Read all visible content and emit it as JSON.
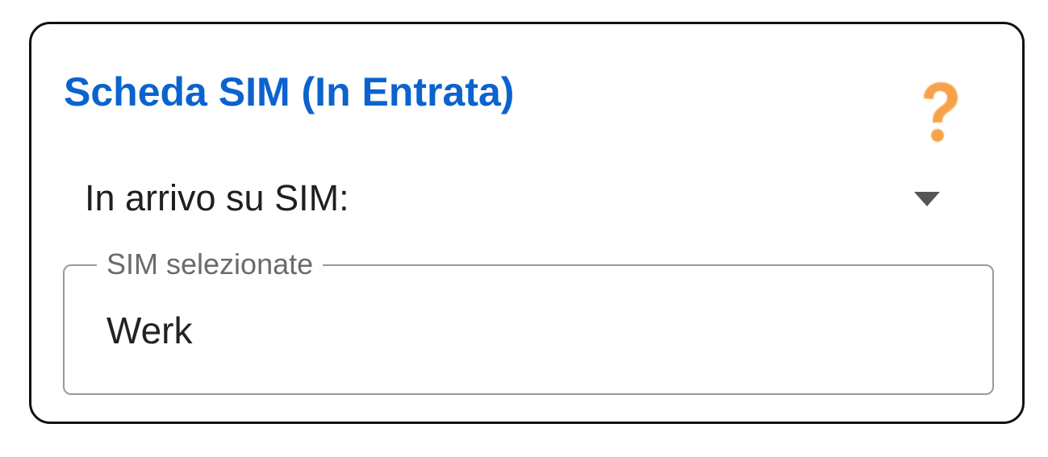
{
  "card": {
    "title": "Scheda SIM (In Entrata)",
    "help_icon": "question-mark-icon"
  },
  "dropdown": {
    "label": "In arrivo su SIM:",
    "caret_icon": "caret-down-icon"
  },
  "field": {
    "legend": "SIM selezionate",
    "value": "Werk"
  },
  "colors": {
    "title": "#0b63ce",
    "help_icon": "#f7a24b",
    "border": "#111111",
    "field_border": "#9a9a9a",
    "caret": "#555555"
  }
}
